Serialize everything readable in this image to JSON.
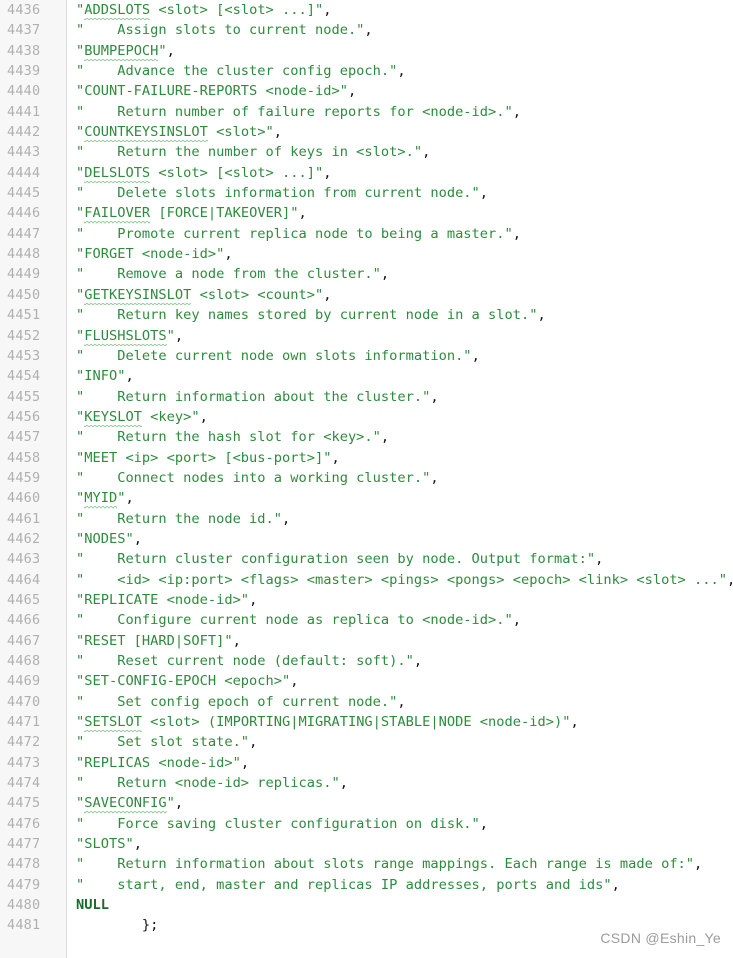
{
  "editor": {
    "language": "c",
    "first_line": 4436,
    "last_line": 4481,
    "gutter_color": "#f7f7f7",
    "background_color": "#ffffff",
    "string_color": "#2e8b3d",
    "keyword_color": "#1a6b2a",
    "line_number_color": "#b0b0b0"
  },
  "watermark": {
    "text": "CSDN @Eshin_Ye"
  },
  "lines": [
    {
      "n": "4436",
      "segs": [
        {
          "t": "\"",
          "c": "str"
        },
        {
          "t": "ADDSLOTS",
          "c": "str sq"
        },
        {
          "t": " <slot> [<slot> ...]\"",
          "c": "str"
        },
        {
          "t": ",",
          "c": "punc"
        }
      ]
    },
    {
      "n": "4437",
      "segs": [
        {
          "t": "\"    Assign slots to current node.\"",
          "c": "str"
        },
        {
          "t": ",",
          "c": "punc"
        }
      ]
    },
    {
      "n": "4438",
      "segs": [
        {
          "t": "\"",
          "c": "str"
        },
        {
          "t": "BUMPEPOCH",
          "c": "str sq"
        },
        {
          "t": "\"",
          "c": "str"
        },
        {
          "t": ",",
          "c": "punc"
        }
      ]
    },
    {
      "n": "4439",
      "segs": [
        {
          "t": "\"    Advance the cluster config epoch.\"",
          "c": "str"
        },
        {
          "t": ",",
          "c": "punc"
        }
      ]
    },
    {
      "n": "4440",
      "segs": [
        {
          "t": "\"COUNT-FAILURE-REPORTS <node-id>\"",
          "c": "str"
        },
        {
          "t": ",",
          "c": "punc"
        }
      ]
    },
    {
      "n": "4441",
      "segs": [
        {
          "t": "\"    Return number of failure reports for <node-id>.\"",
          "c": "str"
        },
        {
          "t": ",",
          "c": "punc"
        }
      ]
    },
    {
      "n": "4442",
      "segs": [
        {
          "t": "\"",
          "c": "str"
        },
        {
          "t": "COUNTKEYSINSLOT",
          "c": "str sq"
        },
        {
          "t": " <slot>\"",
          "c": "str"
        },
        {
          "t": ",",
          "c": "punc"
        }
      ]
    },
    {
      "n": "4443",
      "segs": [
        {
          "t": "\"    Return the number of keys in <slot>.\"",
          "c": "str"
        },
        {
          "t": ",",
          "c": "punc"
        }
      ]
    },
    {
      "n": "4444",
      "segs": [
        {
          "t": "\"",
          "c": "str"
        },
        {
          "t": "DELSLOTS",
          "c": "str sq"
        },
        {
          "t": " <slot> [<slot> ...]\"",
          "c": "str"
        },
        {
          "t": ",",
          "c": "punc"
        }
      ]
    },
    {
      "n": "4445",
      "segs": [
        {
          "t": "\"    Delete slots information from current node.\"",
          "c": "str"
        },
        {
          "t": ",",
          "c": "punc"
        }
      ]
    },
    {
      "n": "4446",
      "segs": [
        {
          "t": "\"",
          "c": "str"
        },
        {
          "t": "FAILOVER",
          "c": "str sq"
        },
        {
          "t": " [FORCE|TAKEOVER]\"",
          "c": "str"
        },
        {
          "t": ",",
          "c": "punc"
        }
      ]
    },
    {
      "n": "4447",
      "segs": [
        {
          "t": "\"    Promote current replica node to being a master.\"",
          "c": "str"
        },
        {
          "t": ",",
          "c": "punc"
        }
      ]
    },
    {
      "n": "4448",
      "segs": [
        {
          "t": "\"FORGET <node-id>\"",
          "c": "str"
        },
        {
          "t": ",",
          "c": "punc"
        }
      ]
    },
    {
      "n": "4449",
      "segs": [
        {
          "t": "\"    Remove a node from the cluster.\"",
          "c": "str"
        },
        {
          "t": ",",
          "c": "punc"
        }
      ]
    },
    {
      "n": "4450",
      "segs": [
        {
          "t": "\"",
          "c": "str"
        },
        {
          "t": "GETKEYSINSLOT",
          "c": "str sq"
        },
        {
          "t": " <slot> <count>\"",
          "c": "str"
        },
        {
          "t": ",",
          "c": "punc"
        }
      ]
    },
    {
      "n": "4451",
      "segs": [
        {
          "t": "\"    Return key names stored by current node in a slot.\"",
          "c": "str"
        },
        {
          "t": ",",
          "c": "punc"
        }
      ]
    },
    {
      "n": "4452",
      "segs": [
        {
          "t": "\"",
          "c": "str"
        },
        {
          "t": "FLUSHSLOTS",
          "c": "str sq"
        },
        {
          "t": "\"",
          "c": "str"
        },
        {
          "t": ",",
          "c": "punc"
        }
      ]
    },
    {
      "n": "4453",
      "segs": [
        {
          "t": "\"    Delete current node own slots information.\"",
          "c": "str"
        },
        {
          "t": ",",
          "c": "punc"
        }
      ]
    },
    {
      "n": "4454",
      "segs": [
        {
          "t": "\"INFO\"",
          "c": "str"
        },
        {
          "t": ",",
          "c": "punc"
        }
      ]
    },
    {
      "n": "4455",
      "segs": [
        {
          "t": "\"    Return information about the cluster.\"",
          "c": "str"
        },
        {
          "t": ",",
          "c": "punc"
        }
      ]
    },
    {
      "n": "4456",
      "segs": [
        {
          "t": "\"",
          "c": "str"
        },
        {
          "t": "KEYSLOT",
          "c": "str sq"
        },
        {
          "t": " <key>\"",
          "c": "str"
        },
        {
          "t": ",",
          "c": "punc"
        }
      ]
    },
    {
      "n": "4457",
      "segs": [
        {
          "t": "\"    Return the hash slot for <key>.\"",
          "c": "str"
        },
        {
          "t": ",",
          "c": "punc"
        }
      ]
    },
    {
      "n": "4458",
      "segs": [
        {
          "t": "\"MEET <ip> <port> [<bus-port>]\"",
          "c": "str"
        },
        {
          "t": ",",
          "c": "punc"
        }
      ]
    },
    {
      "n": "4459",
      "segs": [
        {
          "t": "\"    Connect nodes into a working cluster.\"",
          "c": "str"
        },
        {
          "t": ",",
          "c": "punc"
        }
      ]
    },
    {
      "n": "4460",
      "segs": [
        {
          "t": "\"",
          "c": "str"
        },
        {
          "t": "MYID",
          "c": "str sq"
        },
        {
          "t": "\"",
          "c": "str"
        },
        {
          "t": ",",
          "c": "punc"
        }
      ]
    },
    {
      "n": "4461",
      "segs": [
        {
          "t": "\"    Return the node id.\"",
          "c": "str"
        },
        {
          "t": ",",
          "c": "punc"
        }
      ]
    },
    {
      "n": "4462",
      "segs": [
        {
          "t": "\"NODES\"",
          "c": "str"
        },
        {
          "t": ",",
          "c": "punc"
        }
      ]
    },
    {
      "n": "4463",
      "segs": [
        {
          "t": "\"    Return cluster configuration seen by node. Output format:\"",
          "c": "str"
        },
        {
          "t": ",",
          "c": "punc"
        }
      ]
    },
    {
      "n": "4464",
      "segs": [
        {
          "t": "\"    <id> <ip:port> <flags> <master> <pings> <pongs> <epoch> <link> <slot> ...\"",
          "c": "str"
        },
        {
          "t": ",",
          "c": "punc"
        }
      ]
    },
    {
      "n": "4465",
      "segs": [
        {
          "t": "\"REPLICATE <node-id>\"",
          "c": "str"
        },
        {
          "t": ",",
          "c": "punc"
        }
      ]
    },
    {
      "n": "4466",
      "segs": [
        {
          "t": "\"    Configure current node as replica to <node-id>.\"",
          "c": "str"
        },
        {
          "t": ",",
          "c": "punc"
        }
      ]
    },
    {
      "n": "4467",
      "segs": [
        {
          "t": "\"RESET [HARD|SOFT]\"",
          "c": "str"
        },
        {
          "t": ",",
          "c": "punc"
        }
      ]
    },
    {
      "n": "4468",
      "segs": [
        {
          "t": "\"    Reset current node (default: soft).\"",
          "c": "str"
        },
        {
          "t": ",",
          "c": "punc"
        }
      ]
    },
    {
      "n": "4469",
      "segs": [
        {
          "t": "\"SET-CONFIG-EPOCH <epoch>\"",
          "c": "str"
        },
        {
          "t": ",",
          "c": "punc"
        }
      ]
    },
    {
      "n": "4470",
      "segs": [
        {
          "t": "\"    Set config epoch of current node.\"",
          "c": "str"
        },
        {
          "t": ",",
          "c": "punc"
        }
      ]
    },
    {
      "n": "4471",
      "segs": [
        {
          "t": "\"",
          "c": "str"
        },
        {
          "t": "SETSLOT",
          "c": "str sq"
        },
        {
          "t": " <slot> (IMPORTING|MIGRATING|STABLE|NODE <node-id>)\"",
          "c": "str"
        },
        {
          "t": ",",
          "c": "punc"
        }
      ]
    },
    {
      "n": "4472",
      "segs": [
        {
          "t": "\"    Set slot state.\"",
          "c": "str"
        },
        {
          "t": ",",
          "c": "punc"
        }
      ]
    },
    {
      "n": "4473",
      "segs": [
        {
          "t": "\"REPLICAS <node-id>\"",
          "c": "str"
        },
        {
          "t": ",",
          "c": "punc"
        }
      ]
    },
    {
      "n": "4474",
      "segs": [
        {
          "t": "\"    Return <node-id> replicas.\"",
          "c": "str"
        },
        {
          "t": ",",
          "c": "punc"
        }
      ]
    },
    {
      "n": "4475",
      "segs": [
        {
          "t": "\"",
          "c": "str"
        },
        {
          "t": "SAVECONFIG",
          "c": "str sq"
        },
        {
          "t": "\"",
          "c": "str"
        },
        {
          "t": ",",
          "c": "punc"
        }
      ]
    },
    {
      "n": "4476",
      "segs": [
        {
          "t": "\"    Force saving cluster configuration on disk.\"",
          "c": "str"
        },
        {
          "t": ",",
          "c": "punc"
        }
      ]
    },
    {
      "n": "4477",
      "segs": [
        {
          "t": "\"SLOTS\"",
          "c": "str"
        },
        {
          "t": ",",
          "c": "punc"
        }
      ]
    },
    {
      "n": "4478",
      "segs": [
        {
          "t": "\"    Return information about slots range mappings. Each range is made of:\"",
          "c": "str"
        },
        {
          "t": ",",
          "c": "punc"
        }
      ]
    },
    {
      "n": "4479",
      "segs": [
        {
          "t": "\"    start, end, master and replicas IP addresses, ports and ids\"",
          "c": "str"
        },
        {
          "t": ",",
          "c": "punc"
        }
      ]
    },
    {
      "n": "4480",
      "segs": [
        {
          "t": "NULL",
          "c": "kw"
        }
      ]
    },
    {
      "n": "4481",
      "segs": [
        {
          "t": "        };",
          "c": "punc"
        }
      ]
    }
  ]
}
